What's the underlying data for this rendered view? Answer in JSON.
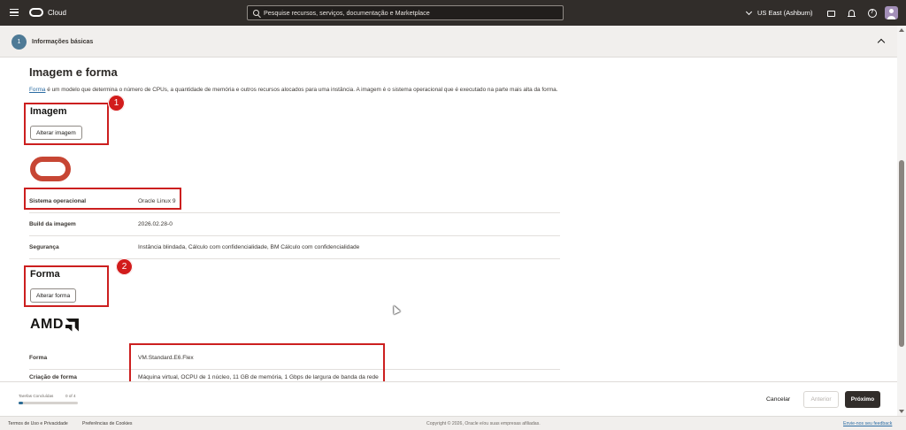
{
  "topbar": {
    "brand": "Cloud",
    "search_placeholder": "Pesquise recursos, serviços, documentação e Marketplace",
    "region": "US East (Ashburn)"
  },
  "step": {
    "number": "1",
    "title": "Informações básicas"
  },
  "section": {
    "title": "Imagem e forma",
    "desc_link": "Forma",
    "desc_text": " é um modelo que determina o número de CPUs, a quantidade de memória e outros recursos alocados para uma instância. A imagem é o sistema operacional que é executado na parte mais alta da forma."
  },
  "image": {
    "heading": "Imagem",
    "change_button": "Alterar imagem",
    "rows": [
      {
        "label": "Sistema operacional",
        "value": "Oracle Linux 9"
      },
      {
        "label": "Build da imagem",
        "value": "2026.02.28-0"
      },
      {
        "label": "Segurança",
        "value": "Instância blindada, Cálculo com confidencialidade, BM Cálculo com confidencialidade"
      }
    ]
  },
  "shape": {
    "heading": "Forma",
    "change_button": "Alterar forma",
    "brand_logo": "AMD",
    "rows": [
      {
        "label": "Forma",
        "value": "VM.Standard.E6.Flex"
      },
      {
        "label": "Criação de forma",
        "value": "Máquina virtual, OCPU de 1 núcleo, 11 GB de memória, 1 Gbps de largura de banda da rede"
      }
    ]
  },
  "annotations": {
    "badge1": "1",
    "badge2": "2",
    "color": "#cc1f1f"
  },
  "actionbar": {
    "tasks_label": "Tarefas Concluídas",
    "tasks_count": "0 of 4",
    "tasks_progress": 0.08,
    "cancel": "Cancelar",
    "previous": "Anterior",
    "next": "Próximo"
  },
  "footer": {
    "terms": "Termos de Uso e Privacidade",
    "cookies": "Preferências de Cookies",
    "copyright": "Copyright © 2026, Oracle e/ou suas empresas afiliadas.",
    "feedback": "Envie-nos seu feedback"
  },
  "colors": {
    "topbar": "#312d2a",
    "accent_red": "#c74634",
    "step_circle": "#4e7a96",
    "link": "#2b6ca3"
  }
}
